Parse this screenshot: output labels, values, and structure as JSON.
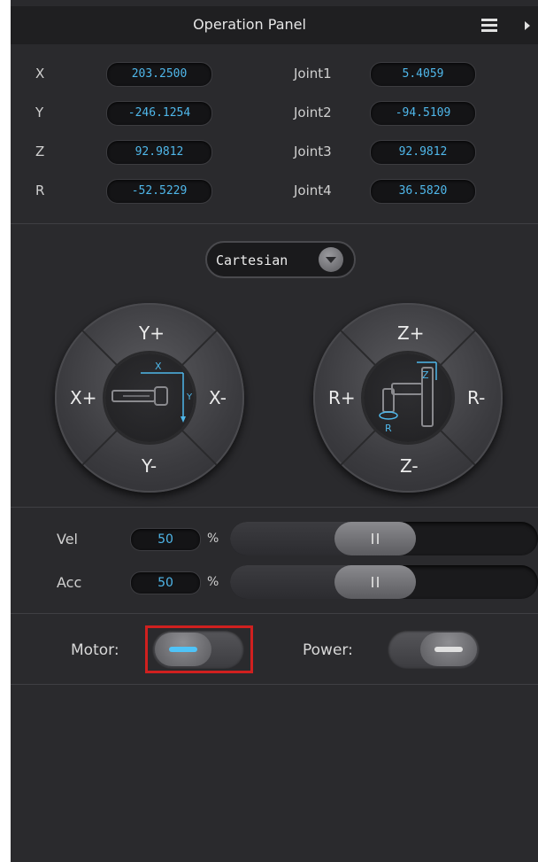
{
  "header": {
    "title": "Operation Panel"
  },
  "icons": {
    "menu": "menu-icon",
    "collapse": "arrow-right-icon"
  },
  "coords": [
    {
      "label": "X",
      "value": "203.2500"
    },
    {
      "label": "Y",
      "value": "-246.1254"
    },
    {
      "label": "Z",
      "value": "92.9812"
    },
    {
      "label": "R",
      "value": "-52.5229"
    }
  ],
  "joints": [
    {
      "label": "Joint1",
      "value": "5.4059"
    },
    {
      "label": "Joint2",
      "value": "-94.5109"
    },
    {
      "label": "Joint3",
      "value": "92.9812"
    },
    {
      "label": "Joint4",
      "value": "36.5820"
    }
  ],
  "mode": {
    "selected": "Cartesian"
  },
  "left_dial": {
    "top": "Y+",
    "left": "X+",
    "right": "X-",
    "bottom": "Y-",
    "icon_x": "X",
    "icon_y": "Y"
  },
  "right_dial": {
    "top": "Z+",
    "left": "R+",
    "right": "R-",
    "bottom": "Z-",
    "icon_z": "Z",
    "icon_r": "R"
  },
  "sliders": {
    "vel": {
      "label": "Vel",
      "value": "50",
      "unit": "%",
      "fraction": 0.5
    },
    "acc": {
      "label": "Acc",
      "value": "50",
      "unit": "%",
      "fraction": 0.5
    }
  },
  "toggles": {
    "motor": {
      "label": "Motor:",
      "state": "on",
      "indicator_color": "#4fc3f7"
    },
    "power": {
      "label": "Power:",
      "state": "off",
      "indicator_color": "#e0e0e0"
    }
  },
  "colors": {
    "accent": "#4fb7ea",
    "highlight": "#d0201f",
    "background": "#2a2a2d"
  }
}
